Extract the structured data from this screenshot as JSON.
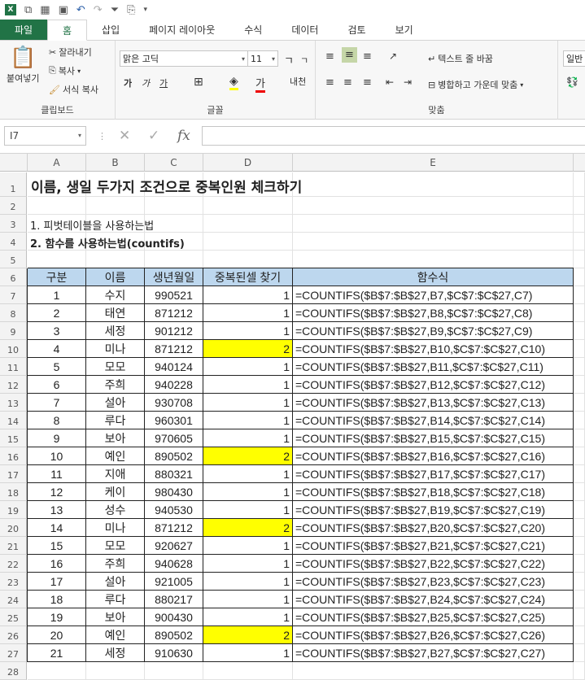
{
  "qat": {
    "undo": "↶",
    "redo": "↷"
  },
  "tabs": [
    "파일",
    "홈",
    "삽입",
    "페이지 레이아웃",
    "수식",
    "데이터",
    "검토",
    "보기"
  ],
  "ribbon": {
    "clipboard": {
      "paste": "붙여넣기",
      "cut": "잘라내기",
      "copy": "복사",
      "format_painter": "서식 복사",
      "label": "클립보드"
    },
    "font": {
      "name": "맑은 고딕",
      "size": "11",
      "label": "글꼴",
      "bold": "가",
      "italic": "가",
      "underline": "가"
    },
    "align": {
      "wrap": "텍스트 줄 바꿈",
      "merge": "병합하고 가운데 맞춤",
      "label": "맞춤"
    },
    "number": {
      "format": "일반"
    }
  },
  "formula_bar": {
    "name_box": "I7",
    "formula": ""
  },
  "columns": [
    "A",
    "B",
    "C",
    "D",
    "E"
  ],
  "sheet": {
    "title": "이름, 생일 두가지 조건으로 중복인원 체크하기",
    "line3": "1. 피벗테이블을 사용하는법",
    "line4": "2. 함수를 사용하는법(countifs)",
    "headers": [
      "구분",
      "이름",
      "생년월일",
      "중복된셀 찾기",
      "함수식"
    ],
    "rows": [
      {
        "no": "1",
        "name": "수지",
        "birth": "990521",
        "dup": "1",
        "formula": "=COUNTIFS($B$7:$B$27,B7,$C$7:$C$27,C7)"
      },
      {
        "no": "2",
        "name": "태연",
        "birth": "871212",
        "dup": "1",
        "formula": "=COUNTIFS($B$7:$B$27,B8,$C$7:$C$27,C8)"
      },
      {
        "no": "3",
        "name": "세정",
        "birth": "901212",
        "dup": "1",
        "formula": "=COUNTIFS($B$7:$B$27,B9,$C$7:$C$27,C9)"
      },
      {
        "no": "4",
        "name": "미나",
        "birth": "871212",
        "dup": "2",
        "formula": "=COUNTIFS($B$7:$B$27,B10,$C$7:$C$27,C10)"
      },
      {
        "no": "5",
        "name": "모모",
        "birth": "940124",
        "dup": "1",
        "formula": "=COUNTIFS($B$7:$B$27,B11,$C$7:$C$27,C11)"
      },
      {
        "no": "6",
        "name": "주희",
        "birth": "940228",
        "dup": "1",
        "formula": "=COUNTIFS($B$7:$B$27,B12,$C$7:$C$27,C12)"
      },
      {
        "no": "7",
        "name": "설아",
        "birth": "930708",
        "dup": "1",
        "formula": "=COUNTIFS($B$7:$B$27,B13,$C$7:$C$27,C13)"
      },
      {
        "no": "8",
        "name": "루다",
        "birth": "960301",
        "dup": "1",
        "formula": "=COUNTIFS($B$7:$B$27,B14,$C$7:$C$27,C14)"
      },
      {
        "no": "9",
        "name": "보아",
        "birth": "970605",
        "dup": "1",
        "formula": "=COUNTIFS($B$7:$B$27,B15,$C$7:$C$27,C15)"
      },
      {
        "no": "10",
        "name": "예인",
        "birth": "890502",
        "dup": "2",
        "formula": "=COUNTIFS($B$7:$B$27,B16,$C$7:$C$27,C16)"
      },
      {
        "no": "11",
        "name": "지애",
        "birth": "880321",
        "dup": "1",
        "formula": "=COUNTIFS($B$7:$B$27,B17,$C$7:$C$27,C17)"
      },
      {
        "no": "12",
        "name": "케이",
        "birth": "980430",
        "dup": "1",
        "formula": "=COUNTIFS($B$7:$B$27,B18,$C$7:$C$27,C18)"
      },
      {
        "no": "13",
        "name": "성수",
        "birth": "940530",
        "dup": "1",
        "formula": "=COUNTIFS($B$7:$B$27,B19,$C$7:$C$27,C19)"
      },
      {
        "no": "14",
        "name": "미나",
        "birth": "871212",
        "dup": "2",
        "formula": "=COUNTIFS($B$7:$B$27,B20,$C$7:$C$27,C20)"
      },
      {
        "no": "15",
        "name": "모모",
        "birth": "920627",
        "dup": "1",
        "formula": "=COUNTIFS($B$7:$B$27,B21,$C$7:$C$27,C21)"
      },
      {
        "no": "16",
        "name": "주희",
        "birth": "940628",
        "dup": "1",
        "formula": "=COUNTIFS($B$7:$B$27,B22,$C$7:$C$27,C22)"
      },
      {
        "no": "17",
        "name": "설아",
        "birth": "921005",
        "dup": "1",
        "formula": "=COUNTIFS($B$7:$B$27,B23,$C$7:$C$27,C23)"
      },
      {
        "no": "18",
        "name": "루다",
        "birth": "880217",
        "dup": "1",
        "formula": "=COUNTIFS($B$7:$B$27,B24,$C$7:$C$27,C24)"
      },
      {
        "no": "19",
        "name": "보아",
        "birth": "900430",
        "dup": "1",
        "formula": "=COUNTIFS($B$7:$B$27,B25,$C$7:$C$27,C25)"
      },
      {
        "no": "20",
        "name": "예인",
        "birth": "890502",
        "dup": "2",
        "formula": "=COUNTIFS($B$7:$B$27,B26,$C$7:$C$27,C26)"
      },
      {
        "no": "21",
        "name": "세정",
        "birth": "910630",
        "dup": "1",
        "formula": "=COUNTIFS($B$7:$B$27,B27,$C$7:$C$27,C27)"
      }
    ]
  },
  "colors": {
    "header_fill": "#bdd7ee",
    "highlight": "#ffff00",
    "excel_green": "#217346"
  }
}
